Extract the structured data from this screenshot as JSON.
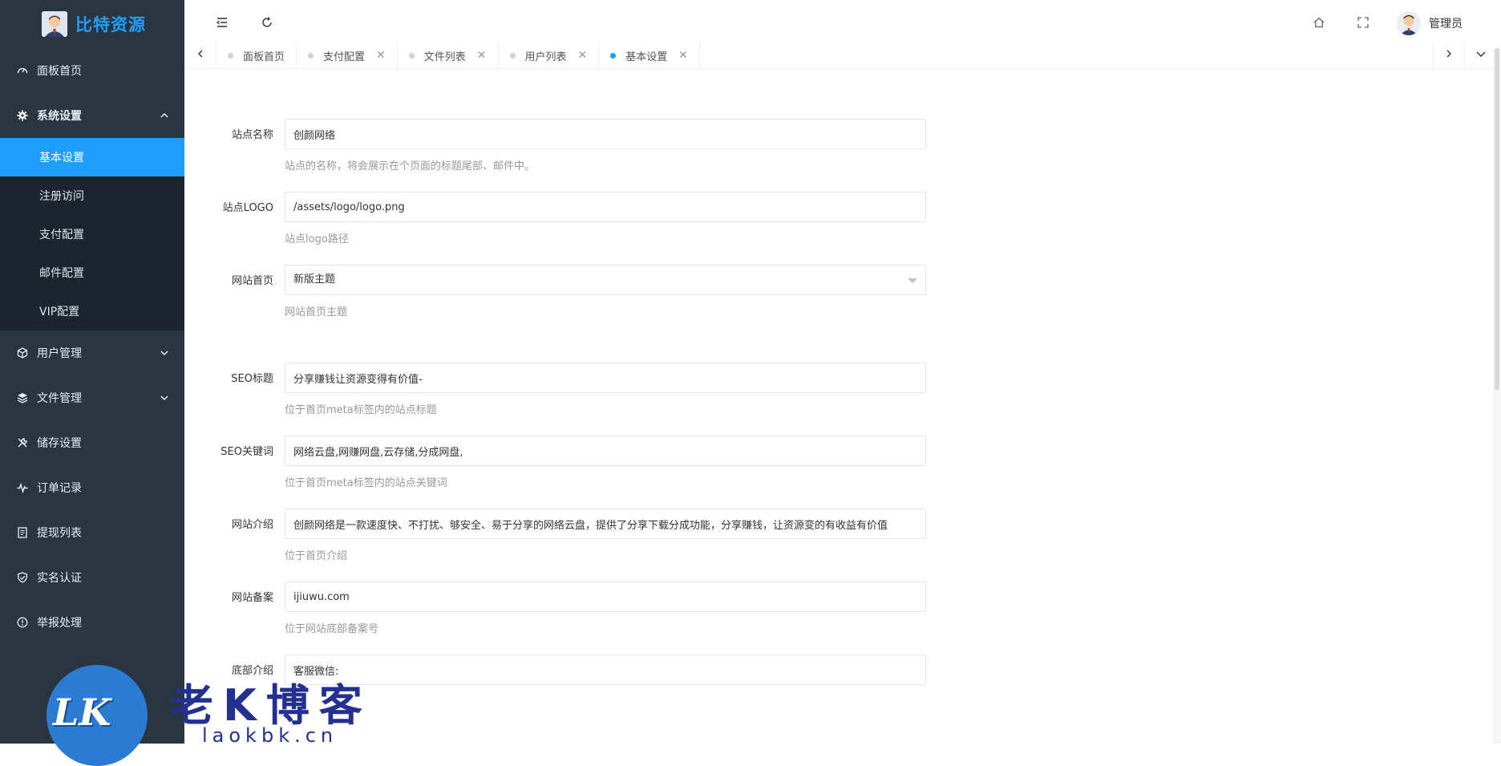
{
  "brand": {
    "name": "比特资源"
  },
  "sidebar": {
    "items": [
      {
        "label": "面板首页",
        "icon": "dashboard-icon"
      },
      {
        "label": "系统设置",
        "icon": "gear-icon",
        "open": true
      },
      {
        "label": "用户管理",
        "icon": "cube-icon"
      },
      {
        "label": "文件管理",
        "icon": "layers-icon"
      },
      {
        "label": "储存设置",
        "icon": "tools-icon"
      },
      {
        "label": "订单记录",
        "icon": "pulse-icon"
      },
      {
        "label": "提现列表",
        "icon": "list-icon"
      },
      {
        "label": "实名认证",
        "icon": "shield-check-icon"
      },
      {
        "label": "举报处理",
        "icon": "info-icon"
      }
    ],
    "submenu": [
      {
        "label": "基本设置",
        "active": true
      },
      {
        "label": "注册访问"
      },
      {
        "label": "支付配置"
      },
      {
        "label": "邮件配置"
      },
      {
        "label": "VIP配置"
      }
    ]
  },
  "header": {
    "user_name": "管理员"
  },
  "tabs": [
    {
      "label": "面板首页",
      "closable": false
    },
    {
      "label": "支付配置",
      "closable": true
    },
    {
      "label": "文件列表",
      "closable": true
    },
    {
      "label": "用户列表",
      "closable": true
    },
    {
      "label": "基本设置",
      "closable": true,
      "active": true
    }
  ],
  "form": {
    "site_name": {
      "label": "站点名称",
      "value": "创颜网络",
      "help": "站点的名称，将会展示在个页面的标题尾部、邮件中。"
    },
    "site_logo": {
      "label": "站点LOGO",
      "value": "/assets/logo/logo.png",
      "help": "站点logo路径"
    },
    "home_theme": {
      "label": "网站首页",
      "value": "新版主题",
      "help": "网站首页主题"
    },
    "seo_title": {
      "label": "SEO标题",
      "value": "分享赚钱让资源变得有价值-",
      "help": "位于首页meta标签内的站点标题"
    },
    "seo_keywords": {
      "label": "SEO关键词",
      "value": "网络云盘,网赚网盘,云存储,分成网盘,",
      "help": "位于首页meta标签内的站点关键词"
    },
    "site_intro": {
      "label": "网站介绍",
      "value": "创颜网络是一款速度快、不打扰、够安全、易于分享的网络云盘，提供了分享下载分成功能，分享赚钱，让资源变的有收益有价值",
      "help": "位于首页介绍"
    },
    "site_icp": {
      "label": "网站备案",
      "value": "ijiuwu.com",
      "help": "位于网站底部备案号"
    },
    "footer_intro": {
      "label": "底部介绍",
      "value": "客服微信:"
    }
  },
  "watermark": {
    "logo_text": "LK",
    "title": "老K博客",
    "url": "laokbk.cn"
  },
  "colors": {
    "sidebar_bg": "#2a3542",
    "submenu_bg": "#1c242e",
    "accent": "#1e9fff"
  }
}
